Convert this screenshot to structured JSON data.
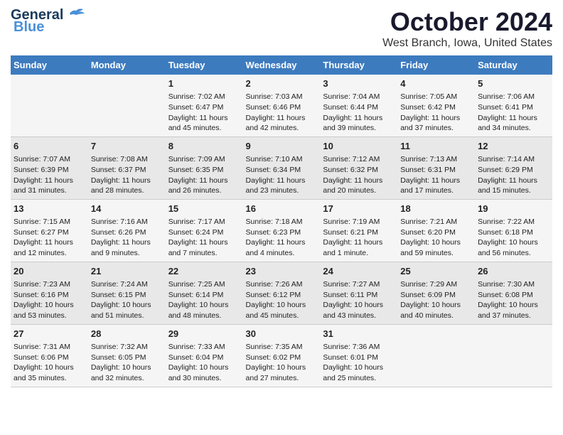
{
  "logo": {
    "general": "General",
    "blue": "Blue"
  },
  "title": "October 2024",
  "subtitle": "West Branch, Iowa, United States",
  "days_of_week": [
    "Sunday",
    "Monday",
    "Tuesday",
    "Wednesday",
    "Thursday",
    "Friday",
    "Saturday"
  ],
  "weeks": [
    [
      {
        "day": "",
        "info": ""
      },
      {
        "day": "",
        "info": ""
      },
      {
        "day": "1",
        "info": "Sunrise: 7:02 AM\nSunset: 6:47 PM\nDaylight: 11 hours and 45 minutes."
      },
      {
        "day": "2",
        "info": "Sunrise: 7:03 AM\nSunset: 6:46 PM\nDaylight: 11 hours and 42 minutes."
      },
      {
        "day": "3",
        "info": "Sunrise: 7:04 AM\nSunset: 6:44 PM\nDaylight: 11 hours and 39 minutes."
      },
      {
        "day": "4",
        "info": "Sunrise: 7:05 AM\nSunset: 6:42 PM\nDaylight: 11 hours and 37 minutes."
      },
      {
        "day": "5",
        "info": "Sunrise: 7:06 AM\nSunset: 6:41 PM\nDaylight: 11 hours and 34 minutes."
      }
    ],
    [
      {
        "day": "6",
        "info": "Sunrise: 7:07 AM\nSunset: 6:39 PM\nDaylight: 11 hours and 31 minutes."
      },
      {
        "day": "7",
        "info": "Sunrise: 7:08 AM\nSunset: 6:37 PM\nDaylight: 11 hours and 28 minutes."
      },
      {
        "day": "8",
        "info": "Sunrise: 7:09 AM\nSunset: 6:35 PM\nDaylight: 11 hours and 26 minutes."
      },
      {
        "day": "9",
        "info": "Sunrise: 7:10 AM\nSunset: 6:34 PM\nDaylight: 11 hours and 23 minutes."
      },
      {
        "day": "10",
        "info": "Sunrise: 7:12 AM\nSunset: 6:32 PM\nDaylight: 11 hours and 20 minutes."
      },
      {
        "day": "11",
        "info": "Sunrise: 7:13 AM\nSunset: 6:31 PM\nDaylight: 11 hours and 17 minutes."
      },
      {
        "day": "12",
        "info": "Sunrise: 7:14 AM\nSunset: 6:29 PM\nDaylight: 11 hours and 15 minutes."
      }
    ],
    [
      {
        "day": "13",
        "info": "Sunrise: 7:15 AM\nSunset: 6:27 PM\nDaylight: 11 hours and 12 minutes."
      },
      {
        "day": "14",
        "info": "Sunrise: 7:16 AM\nSunset: 6:26 PM\nDaylight: 11 hours and 9 minutes."
      },
      {
        "day": "15",
        "info": "Sunrise: 7:17 AM\nSunset: 6:24 PM\nDaylight: 11 hours and 7 minutes."
      },
      {
        "day": "16",
        "info": "Sunrise: 7:18 AM\nSunset: 6:23 PM\nDaylight: 11 hours and 4 minutes."
      },
      {
        "day": "17",
        "info": "Sunrise: 7:19 AM\nSunset: 6:21 PM\nDaylight: 11 hours and 1 minute."
      },
      {
        "day": "18",
        "info": "Sunrise: 7:21 AM\nSunset: 6:20 PM\nDaylight: 10 hours and 59 minutes."
      },
      {
        "day": "19",
        "info": "Sunrise: 7:22 AM\nSunset: 6:18 PM\nDaylight: 10 hours and 56 minutes."
      }
    ],
    [
      {
        "day": "20",
        "info": "Sunrise: 7:23 AM\nSunset: 6:16 PM\nDaylight: 10 hours and 53 minutes."
      },
      {
        "day": "21",
        "info": "Sunrise: 7:24 AM\nSunset: 6:15 PM\nDaylight: 10 hours and 51 minutes."
      },
      {
        "day": "22",
        "info": "Sunrise: 7:25 AM\nSunset: 6:14 PM\nDaylight: 10 hours and 48 minutes."
      },
      {
        "day": "23",
        "info": "Sunrise: 7:26 AM\nSunset: 6:12 PM\nDaylight: 10 hours and 45 minutes."
      },
      {
        "day": "24",
        "info": "Sunrise: 7:27 AM\nSunset: 6:11 PM\nDaylight: 10 hours and 43 minutes."
      },
      {
        "day": "25",
        "info": "Sunrise: 7:29 AM\nSunset: 6:09 PM\nDaylight: 10 hours and 40 minutes."
      },
      {
        "day": "26",
        "info": "Sunrise: 7:30 AM\nSunset: 6:08 PM\nDaylight: 10 hours and 37 minutes."
      }
    ],
    [
      {
        "day": "27",
        "info": "Sunrise: 7:31 AM\nSunset: 6:06 PM\nDaylight: 10 hours and 35 minutes."
      },
      {
        "day": "28",
        "info": "Sunrise: 7:32 AM\nSunset: 6:05 PM\nDaylight: 10 hours and 32 minutes."
      },
      {
        "day": "29",
        "info": "Sunrise: 7:33 AM\nSunset: 6:04 PM\nDaylight: 10 hours and 30 minutes."
      },
      {
        "day": "30",
        "info": "Sunrise: 7:35 AM\nSunset: 6:02 PM\nDaylight: 10 hours and 27 minutes."
      },
      {
        "day": "31",
        "info": "Sunrise: 7:36 AM\nSunset: 6:01 PM\nDaylight: 10 hours and 25 minutes."
      },
      {
        "day": "",
        "info": ""
      },
      {
        "day": "",
        "info": ""
      }
    ]
  ]
}
